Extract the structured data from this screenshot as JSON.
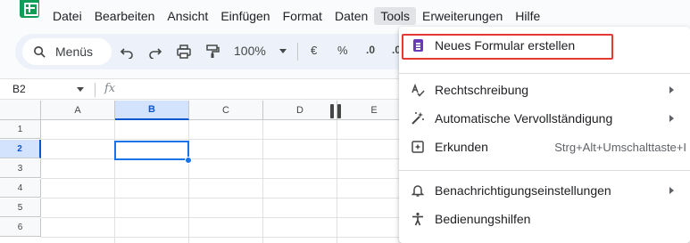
{
  "menubar": {
    "items": [
      "Datei",
      "Bearbeiten",
      "Ansicht",
      "Einfügen",
      "Format",
      "Daten",
      "Tools",
      "Erweiterungen",
      "Hilfe"
    ],
    "active": "Tools"
  },
  "toolbar": {
    "search_label": "Menüs",
    "zoom": "100%",
    "currency": "€",
    "percent": "%",
    "decimal_decrease": ".0",
    "decimal_increase": ".0"
  },
  "formula_bar": {
    "cell_ref": "B2",
    "fx": "fx"
  },
  "grid": {
    "columns": [
      "A",
      "B",
      "C",
      "D",
      "E"
    ],
    "rows": [
      "1",
      "2",
      "3",
      "4",
      "5",
      "6"
    ],
    "selected_column": "B",
    "selected_row": "2"
  },
  "dropdown": {
    "items": [
      {
        "label": "Neues Formular erstellen",
        "icon": "forms-icon"
      },
      {
        "label": "Rechtschreibung",
        "icon": "spellcheck-icon",
        "submenu": true
      },
      {
        "label": "Automatische Vervollständigung",
        "icon": "magic-wand-icon",
        "submenu": true
      },
      {
        "label": "Erkunden",
        "icon": "explore-icon",
        "shortcut": "Strg+Alt+Umschalttaste+I"
      },
      {
        "label": "Benachrichtigungseinstellungen",
        "icon": "bell-icon",
        "submenu": true
      },
      {
        "label": "Bedienungshilfen",
        "icon": "accessibility-icon"
      }
    ]
  },
  "colors": {
    "selection": "#1a73e8",
    "highlight": "#e53935",
    "forms": "#673ab7"
  }
}
